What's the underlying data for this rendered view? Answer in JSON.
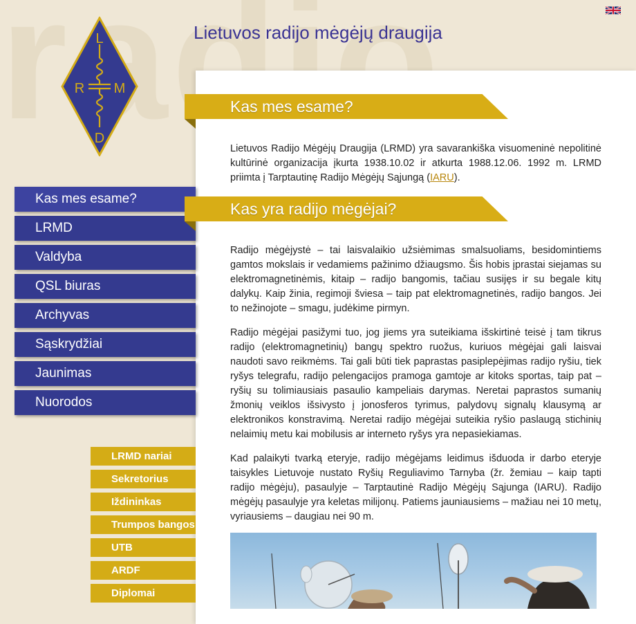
{
  "background_word": "radio",
  "site_title": "Lietuvos radijo mėgėjų draugija",
  "language_flag": {
    "icon": "uk-flag-icon"
  },
  "logo": {
    "letters": [
      "L",
      "R",
      "M",
      "D"
    ],
    "color": "#d4ac16",
    "fill": "#343a8f"
  },
  "nav_main": [
    {
      "label": "Kas mes esame?",
      "active": true
    },
    {
      "label": "LRMD"
    },
    {
      "label": "Valdyba"
    },
    {
      "label": "QSL biuras"
    },
    {
      "label": "Archyvas"
    },
    {
      "label": "Sąskrydžiai"
    },
    {
      "label": "Jaunimas"
    },
    {
      "label": "Nuorodos"
    }
  ],
  "nav_sub": [
    {
      "label": "LRMD nariai"
    },
    {
      "label": "Sekretorius"
    },
    {
      "label": "Iždininkas"
    },
    {
      "label": "Trumpos bangos"
    },
    {
      "label": "UTB"
    },
    {
      "label": "ARDF"
    },
    {
      "label": "Diplomai"
    }
  ],
  "sections": {
    "about": {
      "heading": "Kas mes esame?",
      "text_before_link": "Lietuvos Radijo Mėgėjų Draugija (LRMD) yra savarankiška visuomeninė nepolitinė kultūrinė organizacija įkurta 1938.10.02 ir atkurta 1988.12.06. 1992 m. LRMD priimta į Tarptautinę Radijo Mėgėjų Sąjungą (",
      "link": "IARU",
      "text_after_link": ")."
    },
    "hams": {
      "heading": "Kas yra radijo mėgėjai?",
      "p1": "Radijo mėgėjystė – tai laisvalaikio užsiėmimas smalsuoliams, besidomintiems gamtos mokslais ir vedamiems pažinimo džiaugsmo. Šis hobis įprastai siejamas su elektromagnetinėmis, kitaip – radijo bangomis, tačiau susijęs ir su begale kitų dalykų. Kaip žinia, regimoji šviesa – taip pat elektromagnetinės, radijo bangos. Jei to nežinojote – smagu, judėkime pirmyn.",
      "p2": "Radijo mėgėjai pasižymi tuo, jog jiems yra suteikiama išskirtinė teisė į tam tikrus radijo (elektromagnetinių) bangų spektro ruožus, kuriuos mėgėjai gali laisvai naudoti savo reikmėms. Tai gali būti tiek paprastas pasiplepėjimas radijo ryšiu, tiek ryšys telegrafu, radijo pelengacijos pramoga gamtoje ar kitoks sportas, taip pat – ryšių su tolimiausiais pasaulio kampeliais darymas. Neretai paprastos sumanių žmonių veiklos išsivysto į jonosferos tyrimus, palydovų signalų klausymą ar elektronikos konstravimą. Neretai radijo mėgėjai suteikia ryšio paslaugą stichinių nelaimių metu kai mobilusis ar interneto ryšys yra nepasiekiamas.",
      "p3": "Kad palaikyti tvarką eteryje, radijo mėgėjams leidimus išduoda ir darbo eteryje taisykles Lietuvoje nustato Ryšių Reguliavimo Tarnyba (žr. žemiau – kaip tapti radijo mėgėju), pasaulyje – Tarptautinė Radijo Mėgėjų Sąjunga (IARU). Radijo mėgėjų pasaulyje yra keletas milijonų. Patiems jauniausiems – mažiau nei 10 metų, vyriausiems – daugiau nei 90 m."
    }
  },
  "photo": {
    "icon": "satellite-dish-photo"
  }
}
